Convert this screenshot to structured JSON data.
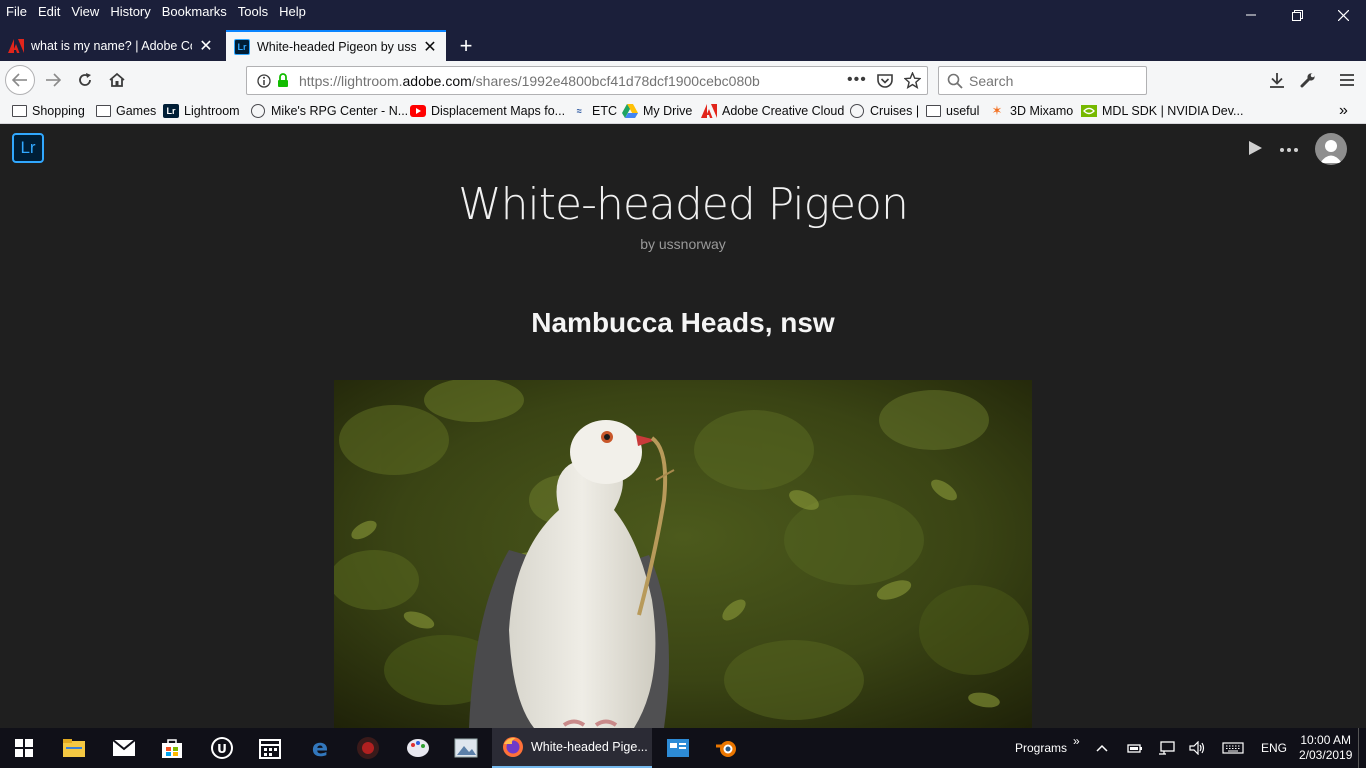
{
  "menubar": {
    "items": [
      "File",
      "Edit",
      "View",
      "History",
      "Bookmarks",
      "Tools",
      "Help"
    ]
  },
  "tabs": [
    {
      "label": "what is my name? | Adobe Com",
      "favicon": "adobe-icon",
      "active": false
    },
    {
      "label": "White-headed Pigeon by ussno",
      "favicon": "lightroom-icon",
      "active": true
    }
  ],
  "nav": {
    "url_prefix": "https://lightroom.",
    "url_domain": "adobe.com",
    "url_suffix": "/shares/1992e4800bcf41d78dcf1900cebc080b",
    "search_placeholder": "Search"
  },
  "bookmarks": [
    {
      "label": "Shopping",
      "icon": "folder-icon"
    },
    {
      "label": "Games",
      "icon": "folder-icon"
    },
    {
      "label": "Lightroom",
      "icon": "lightroom-icon"
    },
    {
      "label": "Mike's RPG Center - N...",
      "icon": "globe-icon"
    },
    {
      "label": "Displacement Maps fo...",
      "icon": "youtube-icon"
    },
    {
      "label": "ETC",
      "icon": "etc-icon"
    },
    {
      "label": "My Drive",
      "icon": "google-drive-icon"
    },
    {
      "label": "Adobe Creative Cloud",
      "icon": "adobe-icon"
    },
    {
      "label": "Cruises |",
      "icon": "globe-icon"
    },
    {
      "label": "useful",
      "icon": "folder-icon"
    },
    {
      "label": "3D Mixamo",
      "icon": "mixamo-icon"
    },
    {
      "label": "MDL SDK | NVIDIA Dev...",
      "icon": "nvidia-icon"
    }
  ],
  "page": {
    "logo_text": "Lr",
    "title": "White-headed Pigeon",
    "author": "by ussnorway",
    "section_heading": "Nambucca Heads, nsw"
  },
  "taskbar": {
    "active_window": "White-headed Pige...",
    "programs_label": "Programs",
    "language": "ENG",
    "time": "10:00 AM",
    "date": "2/03/2019"
  },
  "colors": {
    "titlebar": "#1b1f3a",
    "toolbar": "#f5f6f7",
    "page_bg": "#1f1f1f",
    "lightroom_blue": "#31a8ff",
    "taskbar": "#101018"
  }
}
